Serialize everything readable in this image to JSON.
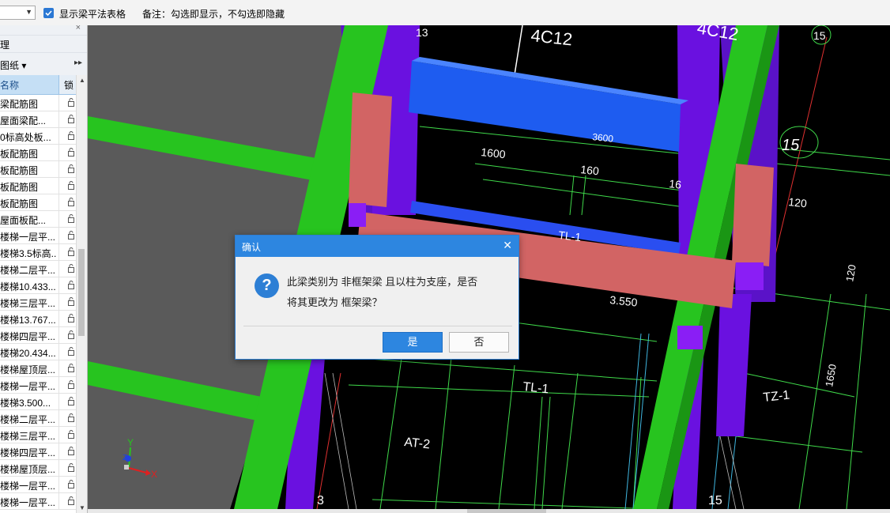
{
  "toolbar": {
    "combo_value": "",
    "show_table_label": "显示梁平法表格",
    "note": "备注：勾选即显示，不勾选即隐藏",
    "show_table_checked": true
  },
  "left_panel": {
    "header_tab": "理",
    "drawing_filter": "图纸",
    "col_name": "名称",
    "col_lock": "锁",
    "rows": [
      "梁配筋图",
      "屋面梁配...",
      "0标高处板...",
      "板配筋图",
      "板配筋图",
      "板配筋图",
      "板配筋图",
      "屋面板配...",
      "楼梯一层平...",
      "楼梯3.5标高...",
      "楼梯二层平...",
      "楼梯10.433...",
      "楼梯三层平...",
      "楼梯13.767...",
      "楼梯四层平...",
      "楼梯20.434...",
      "楼梯屋顶层...",
      "楼梯一层平...",
      "楼梯3.500...",
      "楼梯二层平...",
      "楼梯三层平...",
      "楼梯四层平...",
      "楼梯屋顶层...",
      "楼梯一层平...",
      "楼梯一层平..."
    ]
  },
  "canvas": {
    "labels": {
      "rebar_top": "4C12",
      "rebar_top_right": "4C12",
      "grid_15_top": "15",
      "grid_15_mid": "15",
      "grid_15_bottom": "15",
      "grid_3_bottom": "3",
      "grid_13_top": "13",
      "dim_1600": "1600",
      "dim_3600": "3600",
      "dim_160": "160",
      "dim_16": "16",
      "dim_120_right": "120",
      "dim_120_mid": "120",
      "dim_1650": "1650",
      "beam_tl1_top": "TL-1",
      "beam_tl1_bottom": "TL-1",
      "elev_3550": "3.550",
      "tz1": "TZ-1",
      "at2": "AT-2"
    },
    "axis": {
      "x": "X",
      "y": "Y",
      "z": "Z"
    },
    "colors": {
      "background": "#000000",
      "green_column": "#27c41f",
      "purple_column": "#6a11e0",
      "blue_beam": "#1e5cf0",
      "pink_beam": "#d26464",
      "cad_line_green": "#3fd94a",
      "cad_line_white": "#ffffff",
      "floor_gray": "#5a5a5a"
    }
  },
  "dialog": {
    "title": "确认",
    "close": "✕",
    "message_line1": "此梁类别为 非框架梁 且以柱为支座，是否",
    "message_line2": "将其更改为 框架梁？",
    "yes_label": "是",
    "no_label": "否",
    "icon": "question-icon"
  }
}
